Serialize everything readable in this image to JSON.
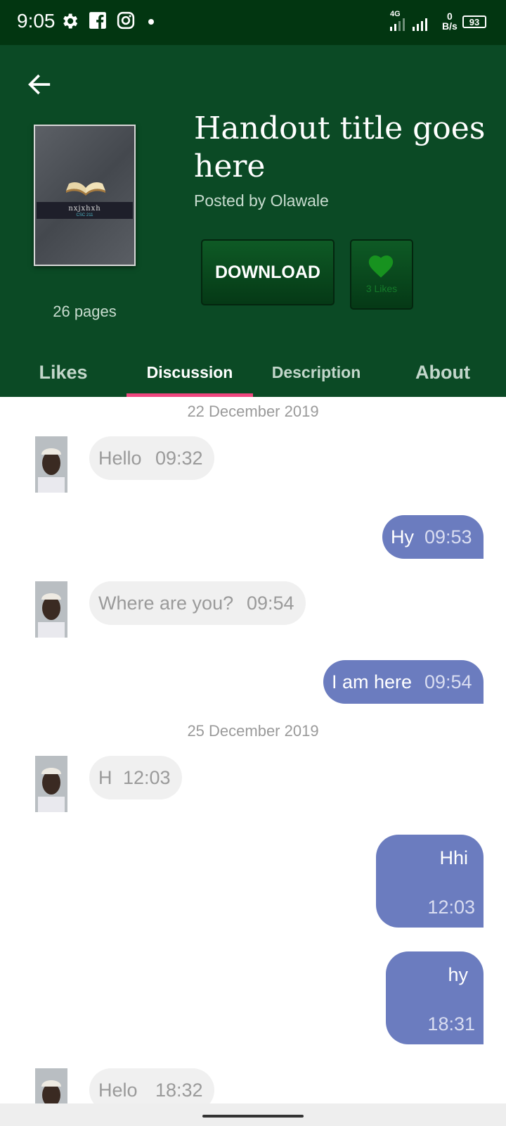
{
  "status_bar": {
    "time": "9:05",
    "network": "4G",
    "speed_value": "0",
    "speed_unit": "B/s",
    "battery": "93",
    "icons": [
      "settings-gear-icon",
      "facebook-icon",
      "instagram-icon",
      "notification-dot-icon",
      "signal-icon",
      "battery-icon"
    ]
  },
  "header": {
    "title": "Handout title goes here",
    "posted_by": "Posted by Olawale",
    "pages": "26 pages",
    "cover_title": "nxjxhxh",
    "cover_subtitle": "CSC 211",
    "download_label": "DOWNLOAD",
    "likes_label": "3 Likes"
  },
  "tabs": [
    {
      "label": "Likes"
    },
    {
      "label": "Discussion",
      "active": true
    },
    {
      "label": "Description"
    },
    {
      "label": "About"
    }
  ],
  "chat": {
    "dates": [
      "22 December 2019",
      "25 December 2019"
    ],
    "messages": [
      {
        "side": "in",
        "text": "Hello",
        "time": "09:32"
      },
      {
        "side": "out",
        "text": "Hy",
        "time": "09:53"
      },
      {
        "side": "in",
        "text": "Where are you?",
        "time": "09:54"
      },
      {
        "side": "out",
        "text": "I am here",
        "time": "09:54"
      },
      {
        "side": "in",
        "text": "H",
        "time": "12:03"
      },
      {
        "side": "out",
        "text": "Hhi",
        "time": "12:03"
      },
      {
        "side": "out",
        "text": "hy",
        "time": "18:31"
      },
      {
        "side": "in",
        "text": "Helo",
        "time": "18:32"
      }
    ]
  },
  "colors": {
    "header_bg": "#0b4a25",
    "status_bar_bg": "#023611",
    "tab_indicator": "#f0467f",
    "outgoing_bubble": "#6b7cbf",
    "incoming_bubble": "#f0f0f0",
    "heart": "#17921f"
  }
}
